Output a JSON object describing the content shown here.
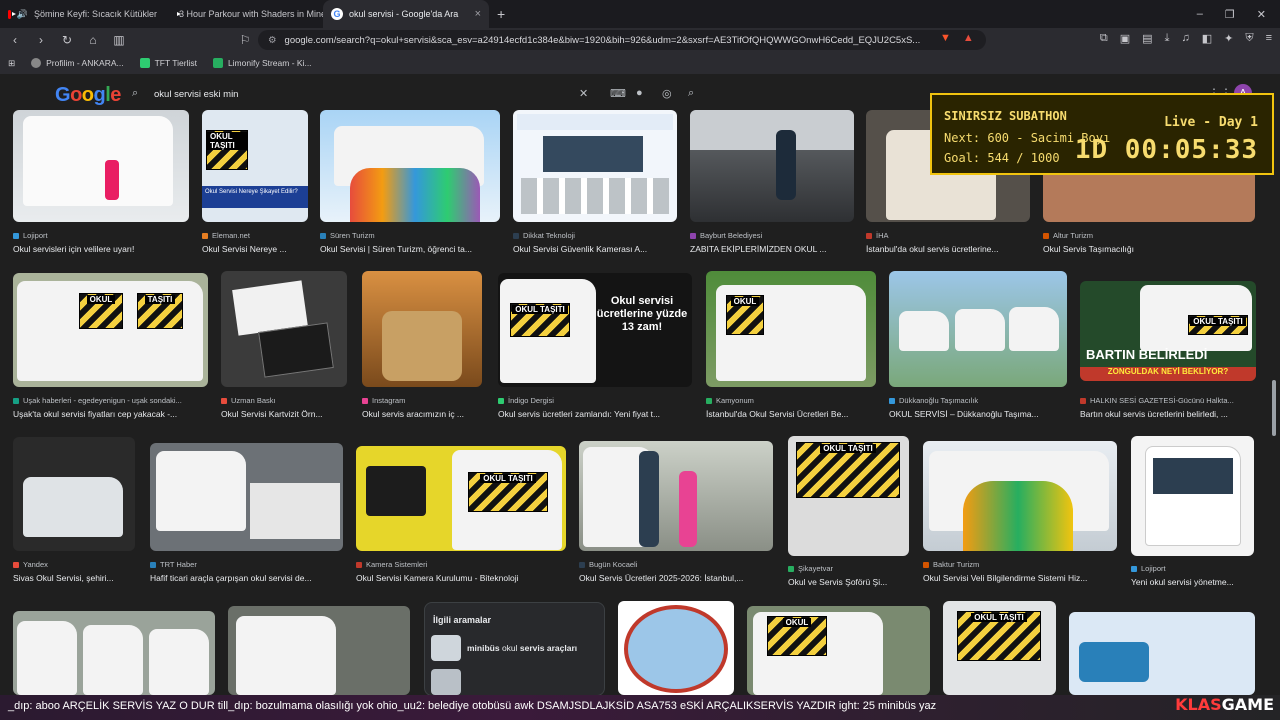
{
  "tabs": [
    {
      "label": "Şömine Keyfi: Sıcacık Kütükler",
      "icon": "youtube-icon"
    },
    {
      "label": "3 Hour Parkour with Shaders in Mine",
      "icon": "youtube-icon"
    },
    {
      "label": "okul servisi - Google'da Ara",
      "icon": "google-icon",
      "active": true
    }
  ],
  "address": {
    "url": "google.com/search?q=okul+servisi&sca_esv=a24914ecfd1c384e&biw=1920&bih=926&udm=2&sxsrf=AE3TifOfQHQWWGOnwH6Cedd_EQJU2C5xS..."
  },
  "bookmarks": [
    {
      "label": "Profilim - ANKARA..."
    },
    {
      "label": "TFT Tierlist"
    },
    {
      "label": "Limonify Stream - Ki..."
    }
  ],
  "google": {
    "logo": "Google",
    "query": "okul servisi eski min"
  },
  "results": [
    {
      "source": "Lojiport",
      "title": "Okul servisleri için velilere uyarı!"
    },
    {
      "source": "Eleman.net",
      "title": "Okul Servisi Nereye ..."
    },
    {
      "source": "Süren Turizm",
      "title": "Okul Servisi | Süren Turizm, öğrenci ta..."
    },
    {
      "source": "Dikkat Teknoloji",
      "title": "Okul Servisi Güvenlik Kamerası A..."
    },
    {
      "source": "Bayburt Belediyesi",
      "title": "ZABITA EKİPLERİMİZDEN OKUL ..."
    },
    {
      "source": "İHA",
      "title": "İstanbul'da okul servis ücretlerine..."
    },
    {
      "source": "Altur Turizm",
      "title": "Okul Servis Taşımacılığı"
    },
    {
      "source": "Uşak haberleri - egedeyenigun - uşak sondaki...",
      "title": "Uşak'ta okul servisi fiyatları cep yakacak -..."
    },
    {
      "source": "Uzman Baskı",
      "title": "Okul Servisi Kartvizit Örn..."
    },
    {
      "source": "Instagram",
      "title": "Okul servis aracımızın iç ..."
    },
    {
      "source": "İndigo Dergisi",
      "title": "Okul servis ücretleri zamlandı: Yeni fiyat t..."
    },
    {
      "source": "Kamyonum",
      "title": "İstanbul'da Okul Servisi Ücretleri Be..."
    },
    {
      "source": "Dükkanoğlu Taşımacılık",
      "title": "OKUL SERVİSİ – Dükkanoğlu Taşıma..."
    },
    {
      "source": "HALKIN SESİ GAZETESİ-Gücünü Halkta...",
      "title": "Bartın okul servis ücretlerini belirledi, ..."
    },
    {
      "source": "Yandex",
      "title": "Sivas Okul Servisi, şehiri..."
    },
    {
      "source": "TRT Haber",
      "title": "Hafif ticari araçla çarpışan okul servisi de..."
    },
    {
      "source": "Kamera Sistemleri",
      "title": "Okul Servisi Kamera Kurulumu - Biteknoloji"
    },
    {
      "source": "Bugün Kocaeli",
      "title": "Okul Servis Ücretleri 2025-2026: İstanbul,..."
    },
    {
      "source": "Şikayetvar",
      "title": "Okul ve Servis Şoförü Şi..."
    },
    {
      "source": "Baktur Turizm",
      "title": "Okul Servisi Veli Bilgilendirme Sistemi Hiz..."
    },
    {
      "source": "Lojiport",
      "title": "Yeni okul servisi yönetme..."
    }
  ],
  "thumb_text": {
    "okul_tasiti": "OKUL TAŞITI",
    "zam": "Okul servisi ücretlerine yüzde 13 zam!",
    "bartin": "BARTIN BELİRLEDİ",
    "bartin_sub": "ZONGULDAK NEYİ BEKLİYOR?",
    "shikayet": "Okul Servisi Nereye Şikayet Edilir?"
  },
  "related": {
    "heading": "İlgili aramalar",
    "item1_bold": "minibüs",
    "item1_rest": " okul ",
    "item1_bold2": "servis araçları"
  },
  "stream_overlay": {
    "title": "SINIRSIZ SUBATHON",
    "next": "Next: 600 - Sacimi Boyı",
    "goal": "Goal: 544 / 1000",
    "live": "Live - Day 1",
    "timer": "1D 00:05:33"
  },
  "ticker": {
    "text": "_dıp: aboo    ARÇELİK SERVİS YAZ O DUR    till_dıp: bozulmama olasılığı yok    ohio_uu2: belediye otobüsü awk    DSAMJSDLAJKSİD    ASA753    eSKİ ARÇALIKSERVİS YAZDIR    ight: 25 minibüs yaz",
    "brand_a": "KLAS",
    "brand_b": "GAME"
  },
  "colors": {
    "accent": "#f1c40f",
    "bg": "#1f1f1f",
    "tabbar": "#1b1b1f"
  }
}
